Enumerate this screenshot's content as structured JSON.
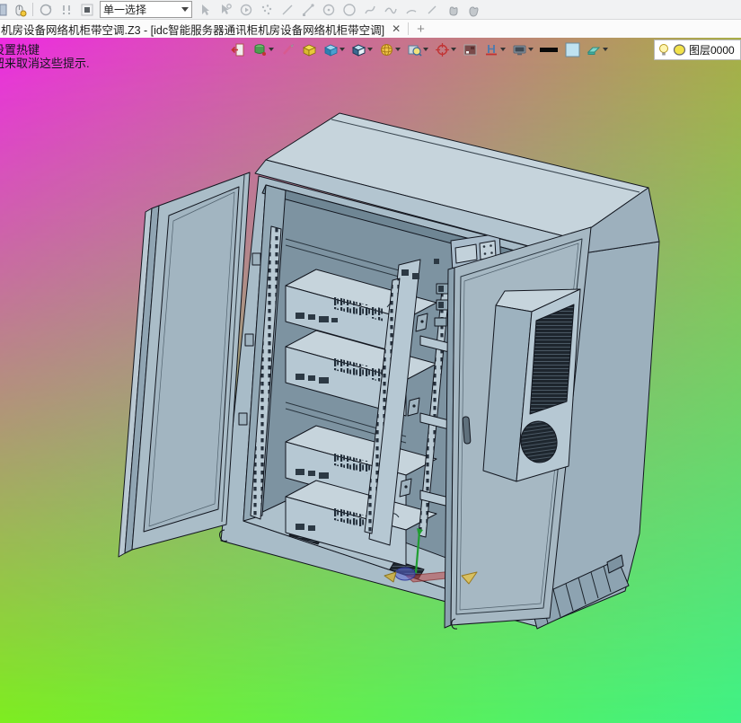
{
  "toolbar_top": {
    "selection_mode": "单一选择",
    "icon_names": [
      "clipped-icon",
      "mouse-hotkey-icon",
      "rotate-view-icon",
      "constraints-icon",
      "stop-icon",
      "cursor-icon",
      "cursor-query-icon",
      "orbit-play-icon",
      "points-icon",
      "line-icon",
      "polyline-icon",
      "circle-center-icon",
      "circle-icon",
      "spline-icon",
      "curve-icon",
      "arc-icon",
      "segment-icon",
      "pan-hand-icon",
      "grab-hand-icon"
    ]
  },
  "tab_bar": {
    "active_tab_title": "机房设备网络机柜带空调.Z3 - [idc智能服务器通讯柜机房设备网络机柜带空调]",
    "close_label": "✕",
    "new_tab_label": "+"
  },
  "view_toolbar": {
    "icon_names": [
      "exit-icon",
      "entity-filter-icon",
      "erase-icon",
      "solid-box-icon",
      "shade-cube-icon",
      "shade-edges-cube-icon",
      "wireframe-sphere-icon",
      "zoom-box-icon",
      "locate-target-icon",
      "render-image-icon",
      "section-view-icon",
      "monitor-icon",
      "line-width-swatch",
      "background-color-swatch",
      "clear-highlight-icon"
    ]
  },
  "layer_bar": {
    "layer_name": "图层0000"
  },
  "hint": {
    "line1": "设置热键",
    "line2": "钮来取消这些提示."
  },
  "viewport_colors": {
    "gradient_top_left": "#ee2ce2",
    "gradient_top_right": "#a9ae47",
    "gradient_bottom_left": "#7dee1f",
    "gradient_bottom_right": "#3ff285",
    "cabinet_body": "#abbfca",
    "edge_line": "#12161f"
  }
}
